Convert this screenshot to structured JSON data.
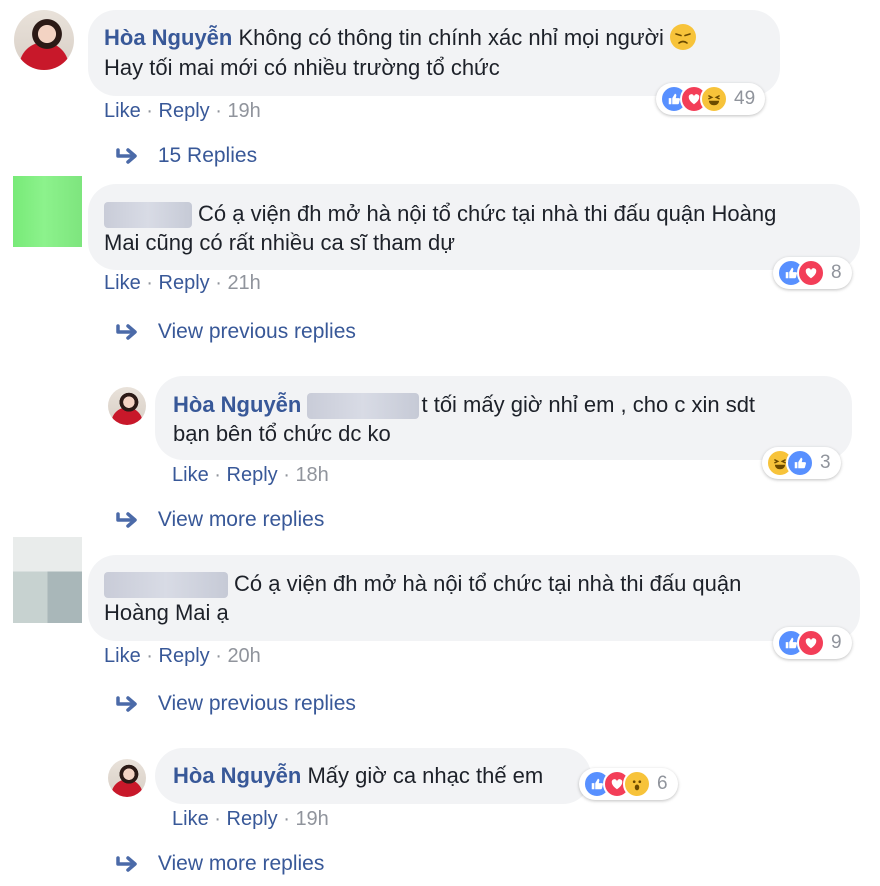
{
  "comments": [
    {
      "author": "Hòa Nguyễn",
      "line1": "Không có thông tin chính xác nhỉ mọi người",
      "line2": "Hay tối mai mới có nhiều trường tổ chức",
      "like": "Like",
      "reply": "Reply",
      "sep": "·",
      "time": "19h",
      "reactions": [
        "like",
        "love",
        "haha"
      ],
      "reaction_count": "49",
      "replies_link": "15 Replies"
    },
    {
      "line1": "Có ạ viện đh mở hà nội tổ chức tại nhà thi đấu quận Hoàng",
      "line2": "Mai cũng có rất nhiều ca sĩ tham dự",
      "like": "Like",
      "reply": "Reply",
      "sep": "·",
      "time": "21h",
      "reactions": [
        "like",
        "love"
      ],
      "reaction_count": "8",
      "replies_link": "View previous replies"
    },
    {
      "author": "Hòa Nguyễn",
      "line1": "t tối mấy giờ nhỉ em , cho c xin sdt",
      "line2": "bạn bên tổ chức dc ko",
      "like": "Like",
      "reply": "Reply",
      "sep": "·",
      "time": "18h",
      "reactions": [
        "haha",
        "like"
      ],
      "reaction_count": "3",
      "replies_link": "View more replies"
    },
    {
      "line1": "Có ạ viện đh mở hà nội tổ chức tại nhà thi đấu quận",
      "line2": "Hoàng Mai ạ",
      "like": "Like",
      "reply": "Reply",
      "sep": "·",
      "time": "20h",
      "reactions": [
        "like",
        "love"
      ],
      "reaction_count": "9",
      "replies_link": "View previous replies"
    },
    {
      "author": "Hòa Nguyễn",
      "line1": "Mấy giờ ca nhạc thế em",
      "like": "Like",
      "reply": "Reply",
      "sep": "·",
      "time": "19h",
      "reactions": [
        "like",
        "love",
        "wow"
      ],
      "reaction_count": "6",
      "replies_link": "View more replies"
    }
  ],
  "icons": {
    "disappointed": "disappointed-face-emoji",
    "reply_arrow": "reply-arrow-icon"
  },
  "colors": {
    "link": "#385898",
    "meta_grey": "#90949c",
    "bubble": "#f2f3f5",
    "like": "#5890ff",
    "love": "#f33e58",
    "haha": "#f7c33a"
  }
}
